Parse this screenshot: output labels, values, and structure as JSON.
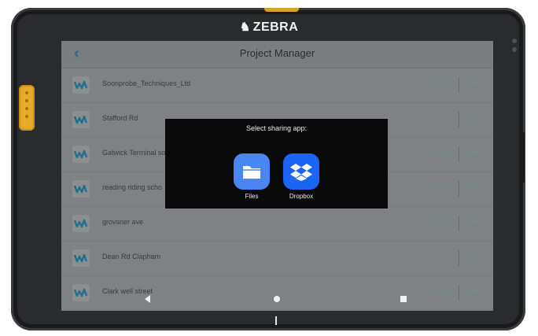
{
  "device": {
    "brand": "ZEBRA"
  },
  "header": {
    "title": "Project Manager"
  },
  "projects": [
    {
      "name": "Soonprobe_Techniques_Ltd",
      "share": "Share",
      "more": "More"
    },
    {
      "name": "Stafford Rd",
      "share": "Share",
      "more": "More"
    },
    {
      "name": "Gatwick Terminal so",
      "share": "Share",
      "more": "More"
    },
    {
      "name": "reading riding scho",
      "share": "Share",
      "more": "More"
    },
    {
      "name": "grovsner ave",
      "share": "Share",
      "more": "More"
    },
    {
      "name": "Dean Rd Clapham",
      "share": "Share",
      "more": "More"
    },
    {
      "name": "Clark well street",
      "share": "Share",
      "more": "More"
    }
  ],
  "dialog": {
    "title": "Select sharing app:",
    "apps": [
      {
        "label": "Files",
        "icon": "folder-icon",
        "color": "#4a86f2"
      },
      {
        "label": "Dropbox",
        "icon": "dropbox-icon",
        "color": "#1a66f2"
      }
    ]
  },
  "colors": {
    "accent": "#1f6f8a",
    "device_accent": "#e7a928"
  }
}
